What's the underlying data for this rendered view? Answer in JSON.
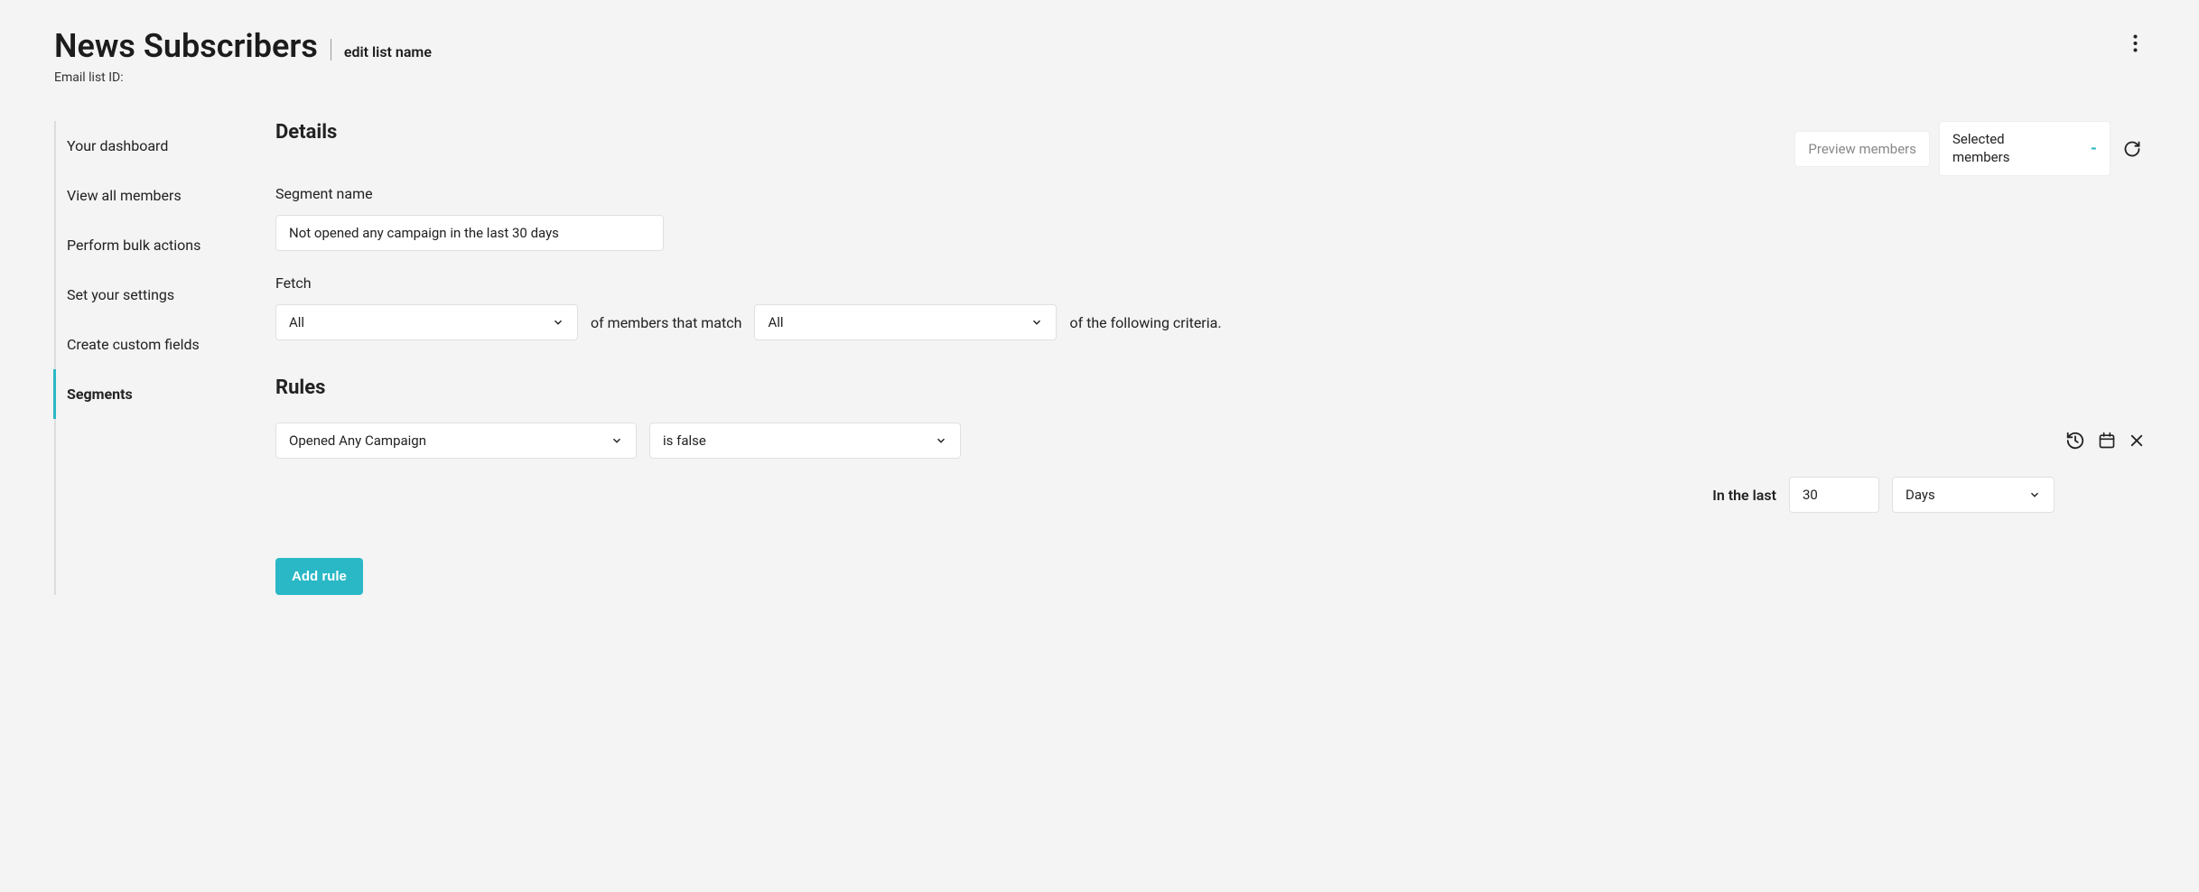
{
  "header": {
    "title": "News Subscribers",
    "edit_link": "edit list name",
    "sub_id_label": "Email list ID:"
  },
  "sidebar": {
    "items": [
      {
        "label": "Your dashboard"
      },
      {
        "label": "View all members"
      },
      {
        "label": "Perform bulk actions"
      },
      {
        "label": "Set your settings"
      },
      {
        "label": "Create custom fields"
      },
      {
        "label": "Segments"
      }
    ]
  },
  "right_panel": {
    "preview": "Preview members",
    "selected_label": "Selected members",
    "selected_value": "-"
  },
  "details": {
    "heading": "Details",
    "segment_name_label": "Segment name",
    "segment_name_value": "Not opened any campaign in the last 30 days",
    "fetch_label": "Fetch",
    "fetch_select": "All",
    "fetch_mid_text": "of members that match",
    "match_select": "All",
    "fetch_end_text": "of the following criteria."
  },
  "rules": {
    "heading": "Rules",
    "field_select": "Opened Any Campaign",
    "condition_select": "is false",
    "timeframe_label": "In the last",
    "timeframe_value": "30",
    "timeframe_unit": "Days",
    "add_button": "Add rule"
  }
}
